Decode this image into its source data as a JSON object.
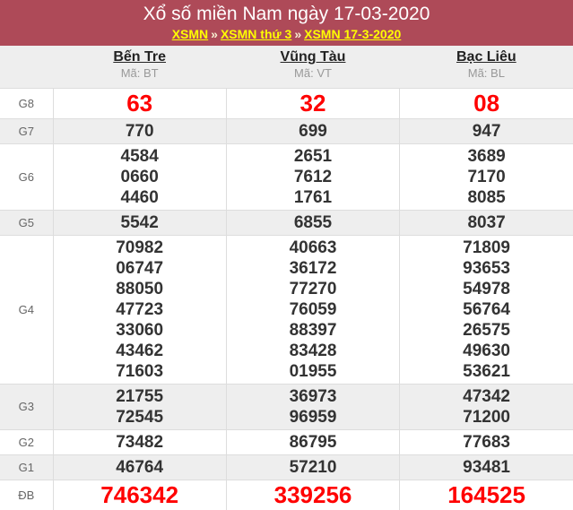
{
  "header": {
    "title": "Xổ số miền Nam ngày 17-03-2020",
    "breadcrumb": [
      {
        "label": "XSMN"
      },
      {
        "label": "XSMN thứ 3"
      },
      {
        "label": "XSMN 17-3-2020"
      }
    ],
    "separator": "»"
  },
  "colors": {
    "header_background": "#ae4a58",
    "breadcrumb_link": "#ffff00",
    "highlight_number": "#ff0000",
    "number_text": "#333333",
    "stripe_row": "#eeeeee",
    "border": "#dddddd"
  },
  "provinces": [
    {
      "name": "Bến Tre",
      "code": "Mã: BT"
    },
    {
      "name": "Vũng Tàu",
      "code": "Mã: VT"
    },
    {
      "name": "Bạc Liêu",
      "code": "Mã: BL"
    }
  ],
  "prizes": [
    {
      "label": "G8",
      "highlight": true,
      "values": [
        [
          "63"
        ],
        [
          "32"
        ],
        [
          "08"
        ]
      ]
    },
    {
      "label": "G7",
      "highlight": false,
      "values": [
        [
          "770"
        ],
        [
          "699"
        ],
        [
          "947"
        ]
      ]
    },
    {
      "label": "G6",
      "highlight": false,
      "values": [
        [
          "4584",
          "0660",
          "4460"
        ],
        [
          "2651",
          "7612",
          "1761"
        ],
        [
          "3689",
          "7170",
          "8085"
        ]
      ]
    },
    {
      "label": "G5",
      "highlight": false,
      "values": [
        [
          "5542"
        ],
        [
          "6855"
        ],
        [
          "8037"
        ]
      ]
    },
    {
      "label": "G4",
      "highlight": false,
      "values": [
        [
          "70982",
          "06747",
          "88050",
          "47723",
          "33060",
          "43462",
          "71603"
        ],
        [
          "40663",
          "36172",
          "77270",
          "76059",
          "88397",
          "83428",
          "01955"
        ],
        [
          "71809",
          "93653",
          "54978",
          "56764",
          "26575",
          "49630",
          "53621"
        ]
      ]
    },
    {
      "label": "G3",
      "highlight": false,
      "values": [
        [
          "21755",
          "72545"
        ],
        [
          "36973",
          "96959"
        ],
        [
          "47342",
          "71200"
        ]
      ]
    },
    {
      "label": "G2",
      "highlight": false,
      "values": [
        [
          "73482"
        ],
        [
          "86795"
        ],
        [
          "77683"
        ]
      ]
    },
    {
      "label": "G1",
      "highlight": false,
      "values": [
        [
          "46764"
        ],
        [
          "57210"
        ],
        [
          "93481"
        ]
      ]
    },
    {
      "label": "ĐB",
      "highlight": true,
      "values": [
        [
          "746342"
        ],
        [
          "339256"
        ],
        [
          "164525"
        ]
      ]
    }
  ]
}
